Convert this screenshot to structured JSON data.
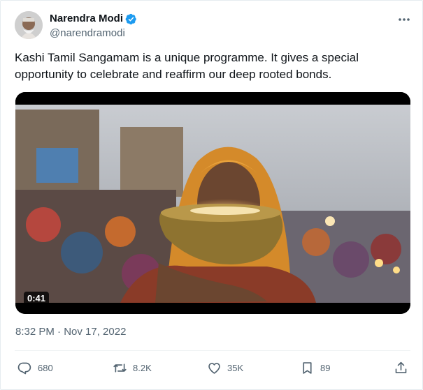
{
  "author": {
    "name": "Narendra Modi",
    "handle": "@narendramodi"
  },
  "icons": {
    "verified": "verified-badge-icon",
    "more": "more-options-icon",
    "reply": "reply-icon",
    "retweet": "retweet-icon",
    "like": "like-icon",
    "bookmark": "bookmark-icon",
    "share": "share-icon"
  },
  "tweet": {
    "text": "Kashi Tamil Sangamam is a unique programme. It gives a special opportunity to celebrate and reaffirm our deep rooted bonds.",
    "timestamp": "8:32 PM · Nov 17, 2022"
  },
  "media": {
    "duration": "0:41"
  },
  "actions": {
    "replies": "680",
    "retweets": "8.2K",
    "likes": "35K",
    "bookmarks": "89"
  },
  "colors": {
    "verified": "#1d9bf0",
    "secondary_text": "#536471"
  }
}
